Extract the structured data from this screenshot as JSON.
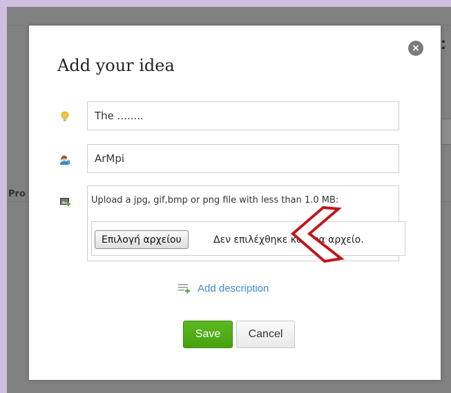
{
  "background": {
    "partial_label": "Pro",
    "partial_glyph": ":"
  },
  "modal": {
    "title": "Add your idea",
    "close_label": "×",
    "fields": {
      "idea_title_value": "The ........",
      "author_value": "ArMpi"
    },
    "upload": {
      "hint": "Upload a jpg, gif,bmp or png file with less than 1.0 MB:",
      "button_label": "Επιλογή αρχείου",
      "status_text": "Δεν επιλέχθηκε κανένα αρχείο."
    },
    "add_description_label": "Add description",
    "save_label": "Save",
    "cancel_label": "Cancel"
  },
  "icons": {
    "idea": "lightbulb-icon",
    "author": "user-icon",
    "upload": "image-add-icon",
    "description": "text-add-icon",
    "close": "close-icon",
    "annotation": "arrow-annotation"
  },
  "colors": {
    "page_bg": "#cdbfdd",
    "overlay": "#818181",
    "save_green": "#4fae15",
    "link_blue": "#3b8bd1",
    "arrow_red": "#c0161b"
  }
}
